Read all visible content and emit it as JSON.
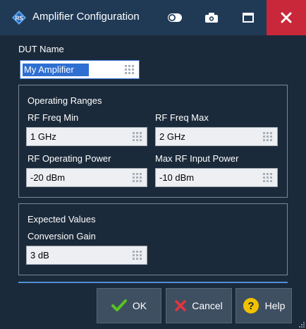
{
  "window": {
    "title": "Amplifier Configuration",
    "accent_color": "#2f6fd1",
    "close_color": "#c8283a"
  },
  "titlebar_buttons": {
    "toggle": "toggle-icon",
    "camera": "camera-icon",
    "maximize": "maximize-icon",
    "close": "close-icon"
  },
  "dut": {
    "label": "DUT Name",
    "value": "My Amplifier"
  },
  "operating_ranges": {
    "title": "Operating Ranges",
    "rf_freq_min": {
      "label": "RF Freq Min",
      "value": "1 GHz"
    },
    "rf_freq_max": {
      "label": "RF Freq Max",
      "value": "2 GHz"
    },
    "rf_operating_power": {
      "label": "RF Operating Power",
      "value": "-20 dBm"
    },
    "max_rf_input_power": {
      "label": "Max RF Input Power",
      "value": "-10 dBm"
    }
  },
  "expected_values": {
    "title": "Expected Values",
    "conversion_gain": {
      "label": "Conversion Gain",
      "value": "3 dB"
    }
  },
  "buttons": {
    "ok": "OK",
    "cancel": "Cancel",
    "help": "Help"
  }
}
